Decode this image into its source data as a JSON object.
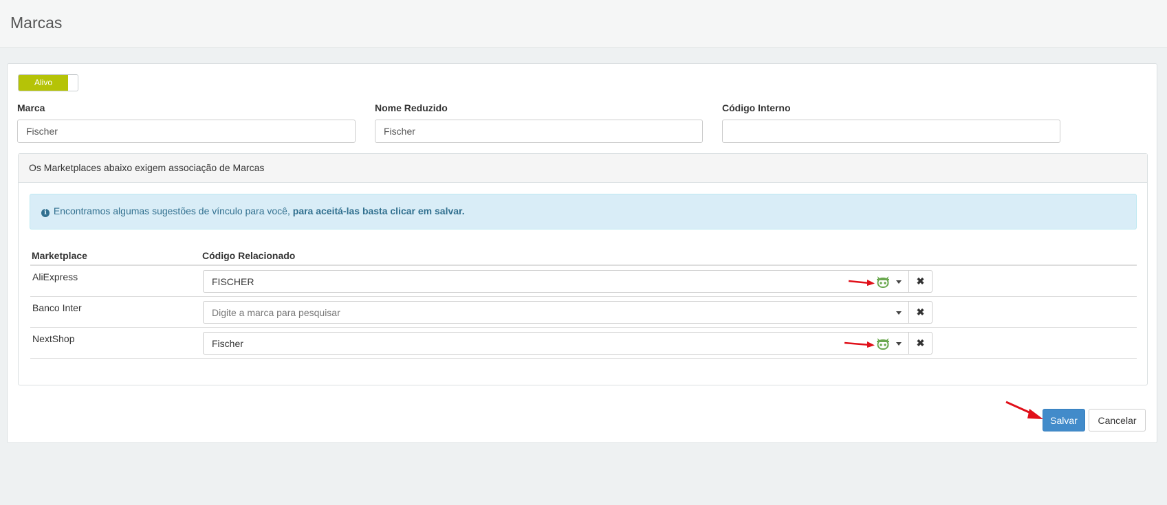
{
  "header": {
    "title": "Marcas"
  },
  "form": {
    "status_toggle": "Alivo",
    "marca": {
      "label": "Marca",
      "value": "Fischer"
    },
    "nome_reduzido": {
      "label": "Nome Reduzido",
      "value": "Fischer"
    },
    "codigo_interno": {
      "label": "Código Interno",
      "value": ""
    }
  },
  "panel": {
    "heading": "Os Marketplaces abaixo exigem associação de Marcas",
    "alert": {
      "text": "Encontramos algumas sugestões de vínculo para você,",
      "bold": "para aceitá-las basta clicar em salvar."
    },
    "table": {
      "columns": [
        "Marketplace",
        "Código Relacionado"
      ],
      "rows": [
        {
          "marketplace": "AliExpress",
          "value": "FISCHER",
          "placeholder": "",
          "suggested": true
        },
        {
          "marketplace": "Banco Inter",
          "value": "",
          "placeholder": "Digite a marca para pesquisar",
          "suggested": false
        },
        {
          "marketplace": "NextShop",
          "value": "Fischer",
          "placeholder": "",
          "suggested": true
        }
      ]
    }
  },
  "actions": {
    "save": "Salvar",
    "cancel": "Cancelar"
  },
  "icons": {
    "info": "info-circle-icon",
    "suggestion": "robot-icon",
    "clear": "times-icon",
    "dropdown": "caret-down-icon"
  },
  "colors": {
    "toggle_on": "#b5c307",
    "primary": "#428bca",
    "alert_bg": "#d9edf7",
    "alert_text": "#31708f",
    "robot": "#6aa84f",
    "annotation_arrow": "#e0101a"
  }
}
